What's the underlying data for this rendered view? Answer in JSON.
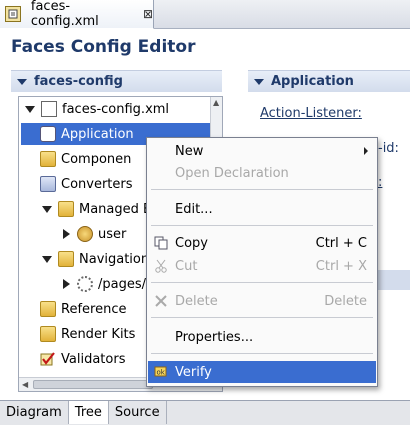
{
  "editor_tab": {
    "title": "faces-config.xml",
    "close": "⊠"
  },
  "page_title": "Faces Config Editor",
  "left_section": {
    "title": "faces-config"
  },
  "tree": [
    {
      "label": "faces-config.xml"
    },
    {
      "label": "Application"
    },
    {
      "label": "Componen"
    },
    {
      "label": "Converters"
    },
    {
      "label": "Managed B"
    },
    {
      "label": "user"
    },
    {
      "label": "Navigation"
    },
    {
      "label": "/pages/i"
    },
    {
      "label": "Reference"
    },
    {
      "label": "Render Kits"
    },
    {
      "label": "Validators"
    }
  ],
  "right_section": {
    "title": "Application",
    "action_listener": "Action-Listener:",
    "partial_1": "-id:",
    "partial_2": ":"
  },
  "context_menu": {
    "new": "New",
    "open_declaration": "Open Declaration",
    "edit": "Edit...",
    "copy": "Copy",
    "copy_shortcut": "Ctrl + C",
    "cut": "Cut",
    "cut_shortcut": "Ctrl + X",
    "delete": "Delete",
    "delete_shortcut": "Delete",
    "properties": "Properties...",
    "verify": "Verify"
  },
  "bottom_tabs": [
    "Diagram",
    "Tree",
    "Source"
  ],
  "colors": {
    "selection": "#3a6dd0",
    "title": "#1f3a6a"
  }
}
